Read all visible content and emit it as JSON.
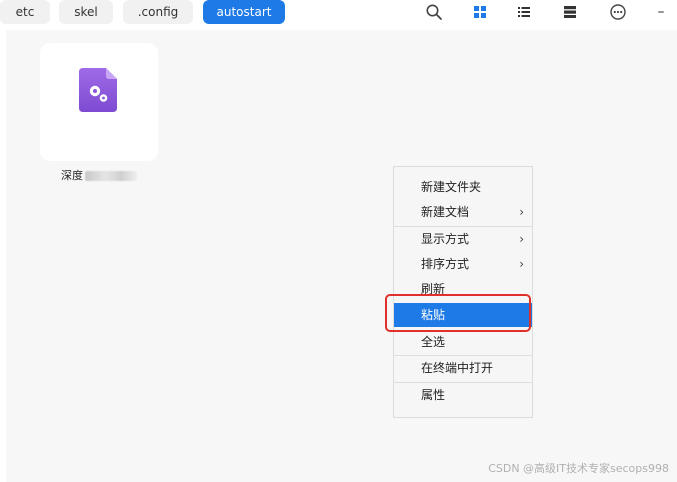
{
  "breadcrumbs": [
    {
      "label": "etc"
    },
    {
      "label": "skel"
    },
    {
      "label": ".config"
    },
    {
      "label": "autostart"
    }
  ],
  "toolbar": {
    "search_icon": "search-icon",
    "icon_view_icon": "grid-view-icon",
    "list_view_icon": "list-view-icon",
    "detail_view_icon": "detail-view-icon",
    "more_icon": "more-icon",
    "minimize_icon": "minimize-icon",
    "minimize_glyph": "–"
  },
  "file": {
    "name_visible": "深度",
    "icon": "settings-file-icon",
    "accent": "#8a56d9"
  },
  "context_menu": {
    "items": [
      {
        "label": "新建文件夹"
      },
      {
        "label": "新建文档",
        "arrow": "›"
      },
      {
        "label": "显示方式",
        "arrow": "›"
      },
      {
        "label": "排序方式",
        "arrow": "›"
      },
      {
        "label": "刷新"
      },
      {
        "label": "粘贴"
      },
      {
        "label": "全选"
      },
      {
        "label": "在终端中打开"
      },
      {
        "label": "属性"
      }
    ]
  },
  "watermark": "CSDN @高级IT技术专家secops998",
  "colors": {
    "accent": "#1e7ae6",
    "highlight_frame": "#e0302a"
  }
}
